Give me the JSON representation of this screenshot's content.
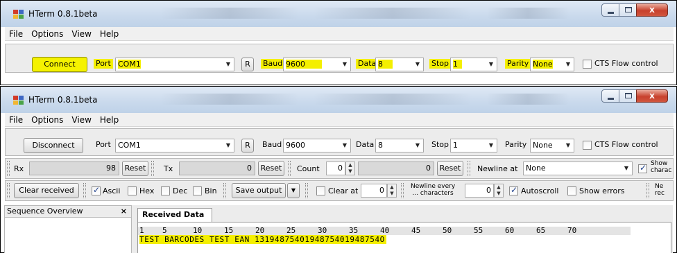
{
  "window": {
    "title_top": "HTerm 0.8.1beta",
    "title_bottom": "HTerm 0.8.1beta",
    "close_glyph": "x"
  },
  "menu": {
    "items": [
      "File",
      "Options",
      "View",
      "Help"
    ]
  },
  "connection_top": {
    "button": "Connect",
    "port_label": "Port",
    "port_value": "COM1",
    "refresh": "R",
    "baud_label": "Baud",
    "baud_value": "9600",
    "data_label": "Data",
    "data_value": "8",
    "stop_label": "Stop",
    "stop_value": "1",
    "parity_label": "Parity",
    "parity_value": "None",
    "cts_label": "CTS Flow control"
  },
  "connection_bottom": {
    "button": "Disconnect",
    "port_label": "Port",
    "port_value": "COM1",
    "refresh": "R",
    "baud_label": "Baud",
    "baud_value": "9600",
    "data_label": "Data",
    "data_value": "8",
    "stop_label": "Stop",
    "stop_value": "1",
    "parity_label": "Parity",
    "parity_value": "None",
    "cts_label": "CTS Flow control"
  },
  "counters": {
    "rx_label": "Rx",
    "rx_value": "98",
    "rx_reset": "Reset",
    "tx_label": "Tx",
    "tx_value": "0",
    "tx_reset": "Reset",
    "count_label": "Count",
    "count_value": "0",
    "count_field": "0",
    "count_reset": "Reset",
    "newline_label": "Newline at",
    "newline_value": "None",
    "show_label": "Show",
    "show_label2": "charac"
  },
  "options": {
    "clear_received": "Clear received",
    "ascii": "Ascii",
    "hex": "Hex",
    "dec": "Dec",
    "bin": "Bin",
    "save_output": "Save output",
    "clear_at": "Clear at",
    "clear_at_value": "0",
    "newline_every_1": "Newline every",
    "newline_every_2": "... characters",
    "newline_every_value": "0",
    "autoscroll": "Autoscroll",
    "show_errors": "Show errors",
    "ne_1": "Ne",
    "ne_2": "rec"
  },
  "sequence": {
    "title": "Sequence Overview",
    "close": "×"
  },
  "received": {
    "tab": "Received Data",
    "ruler": [
      "1",
      "5",
      "10",
      "15",
      "20",
      "25",
      "30",
      "35",
      "40",
      "45",
      "50",
      "55",
      "60",
      "65",
      "70"
    ],
    "text": "TEST BARCODES TEST EAN 1319487540194875401948754O"
  },
  "colors": {
    "highlight": "#f4ef00",
    "titlebar": "#c9d9ec",
    "close": "#c8412d"
  }
}
